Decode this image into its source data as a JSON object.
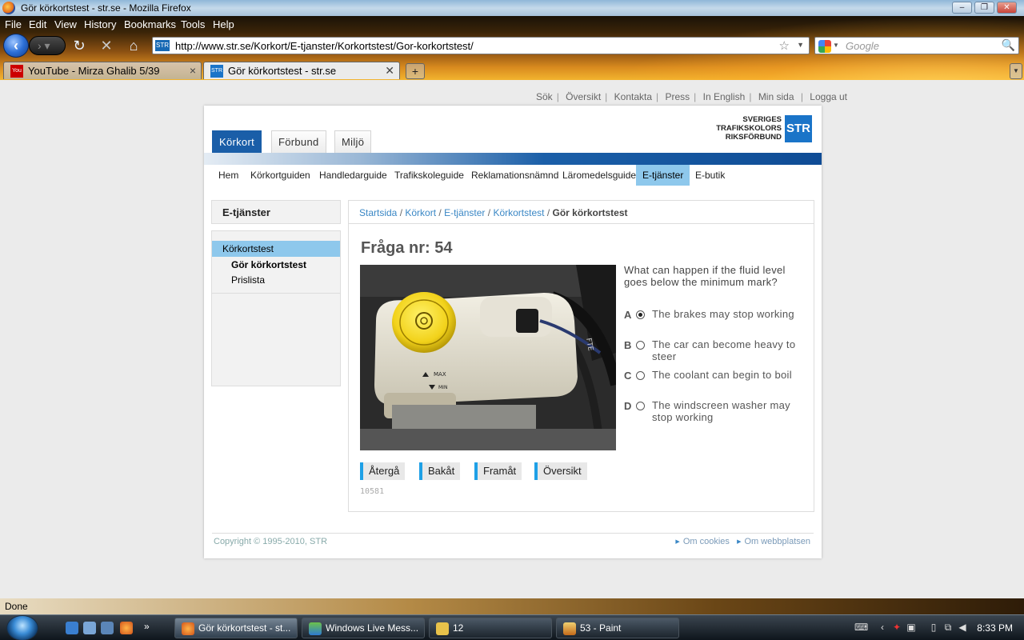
{
  "window": {
    "title": "Gör körkortstest - str.se - Mozilla Firefox"
  },
  "menubar": {
    "items": [
      "File",
      "Edit",
      "View",
      "History",
      "Bookmarks",
      "Tools",
      "Help"
    ]
  },
  "navbar": {
    "url": "http://www.str.se/Korkort/E-tjanster/Korkortstest/Gor-korkortstest/",
    "search_placeholder": "Google"
  },
  "tabs": [
    {
      "label": "YouTube - Mirza Ghalib 5/39",
      "icon": "youtube-icon",
      "active": false
    },
    {
      "label": "Gör körkortstest - str.se",
      "icon": "str-favicon",
      "active": true
    }
  ],
  "site": {
    "toplinks": [
      "Sök",
      "Översikt",
      "Kontakta",
      "Press",
      "In English",
      "Min sida",
      "Logga ut"
    ],
    "section_tabs": [
      "Körkort",
      "Förbund",
      "Miljö"
    ],
    "logo": {
      "line1": "SVERIGES",
      "line2": "TRAFIKSKOLORS",
      "line3": "RIKSFÖRBUND",
      "mark": "STR"
    },
    "subnav": [
      "Hem",
      "Körkortguiden",
      "Handledarguide",
      "Trafikskoleguide",
      "Reklamationsnämnd",
      "Läromedelsguide",
      "E-tjänster",
      "E-butik"
    ],
    "subnav_active": "E-tjänster",
    "left": {
      "heading": "E-tjänster",
      "top_item": "Körkortstest",
      "selected_item": "Gör körkortstest",
      "item": "Prislista"
    },
    "breadcrumb": [
      "Startsida",
      "Körkort",
      "E-tjänster",
      "Körkortstest"
    ],
    "breadcrumb_current": "Gör körkortstest",
    "question": {
      "title": "Fråga nr: 54",
      "text": "What can happen if the fluid level goes below the minimum mark?",
      "options": [
        {
          "letter": "A",
          "text": "The brakes may stop working",
          "selected": true
        },
        {
          "letter": "B",
          "text": "The car can become heavy to steer",
          "selected": false
        },
        {
          "letter": "C",
          "text": "The coolant can begin to boil",
          "selected": false
        },
        {
          "letter": "D",
          "text": "The windscreen washer may stop working",
          "selected": false
        }
      ],
      "photo_labels": {
        "max": "MAX",
        "min": "MIN",
        "fte": "FTE"
      },
      "buttons": [
        "Återgå",
        "Bakåt",
        "Framåt",
        "Översikt"
      ],
      "id": "10581"
    },
    "footer": {
      "copyright": "Copyright © 1995-2010, STR",
      "links": [
        "Om cookies",
        "Om webbplatsen"
      ]
    }
  },
  "status": {
    "text": "Done"
  },
  "taskbar": {
    "buttons": [
      {
        "label": "Gör körkortstest - st...",
        "icon": "firefox-icon",
        "active": true
      },
      {
        "label": "Windows Live Mess...",
        "icon": "messenger-icon",
        "active": false
      },
      {
        "label": "12",
        "icon": "folder-icon",
        "active": false
      },
      {
        "label": "53 - Paint",
        "icon": "paint-icon",
        "active": false
      }
    ],
    "clock": "8:33 PM"
  },
  "colors": {
    "str_blue": "#1a5ea8",
    "highlight": "#8ec8ec",
    "link": "#3a87c5"
  }
}
